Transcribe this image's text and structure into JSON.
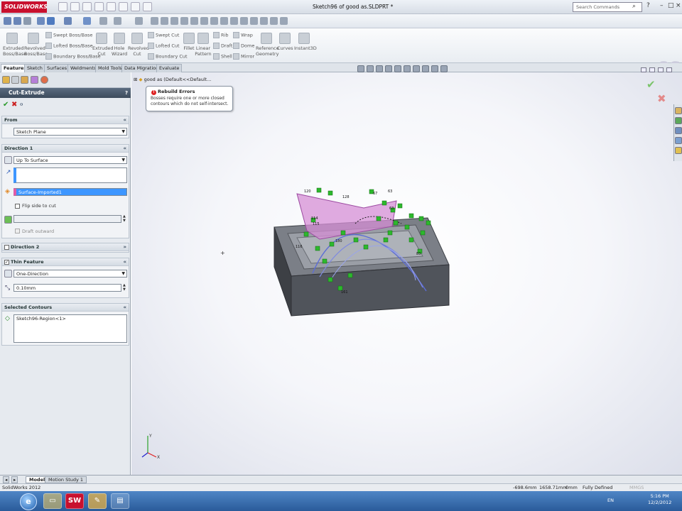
{
  "app": {
    "logo": "SOLIDWORKS",
    "window_title": "Sketch96 of good as.SLDPRT *",
    "search_placeholder": "Search Commands"
  },
  "ribbon": {
    "extruded_boss": "Extruded Boss/Base",
    "revolved_boss": "Revolved Boss/Base",
    "swept_boss": "Swept Boss/Base",
    "lofted_boss": "Lofted Boss/Base",
    "boundary_boss": "Boundary Boss/Base",
    "extruded_cut": "Extruded Cut",
    "hole_wizard": "Hole Wizard",
    "revolved_cut": "Revolved Cut",
    "swept_cut": "Swept Cut",
    "lofted_cut": "Lofted Cut",
    "boundary_cut": "Boundary Cut",
    "fillet": "Fillet",
    "linear_pattern": "Linear Pattern",
    "rib": "Rib",
    "draft": "Draft",
    "shell": "Shell",
    "wrap": "Wrap",
    "dome": "Dome",
    "mirror": "Mirror",
    "reference_geometry": "Reference Geometry",
    "curves": "Curves",
    "instant3d": "Instant3D"
  },
  "tabs": [
    "Features",
    "Sketch",
    "Surfaces",
    "Weldments",
    "Mold Tools",
    "Data Migration",
    "Evaluate"
  ],
  "property_manager": {
    "title": "Cut-Extrude",
    "help": "?",
    "from": {
      "header": "From",
      "value": "Sketch Plane"
    },
    "direction1": {
      "header": "Direction 1",
      "end_condition": "Up To Surface",
      "face_value": "",
      "surface_value": "Surface-Imported1",
      "flip_label": "Flip side to cut",
      "draft_label": "Draft outward"
    },
    "direction2": {
      "header": "Direction 2"
    },
    "thin_feature": {
      "header": "Thin Feature",
      "type": "One-Direction",
      "thickness": "0.10mm"
    },
    "selected_contours": {
      "header": "Selected Contours",
      "item": "Sketch96-Region<1>"
    }
  },
  "viewport": {
    "tree_item": "good as  (Default<<Default..."
  },
  "tooltip": {
    "title": "Rebuild Errors",
    "body": "Bosses require one or more closed contours which do not self-intersect."
  },
  "bottom_tabs": [
    "Model",
    "Motion Study 1"
  ],
  "status": {
    "app_version": "SolidWorks 2012",
    "x": "-698.6mm",
    "y": "1658.71mm",
    "z": "0mm",
    "state": "Fully Defined",
    "units": "MMGS"
  },
  "taskbar": {
    "lang": "EN",
    "time": "5:16 PM",
    "date": "12/2/2012"
  },
  "colors": {
    "accent": "#3d4b5c",
    "surface_pink": "#d58fd6",
    "sketch_green": "#2db82d",
    "selection_blue": "#3d96ff"
  }
}
